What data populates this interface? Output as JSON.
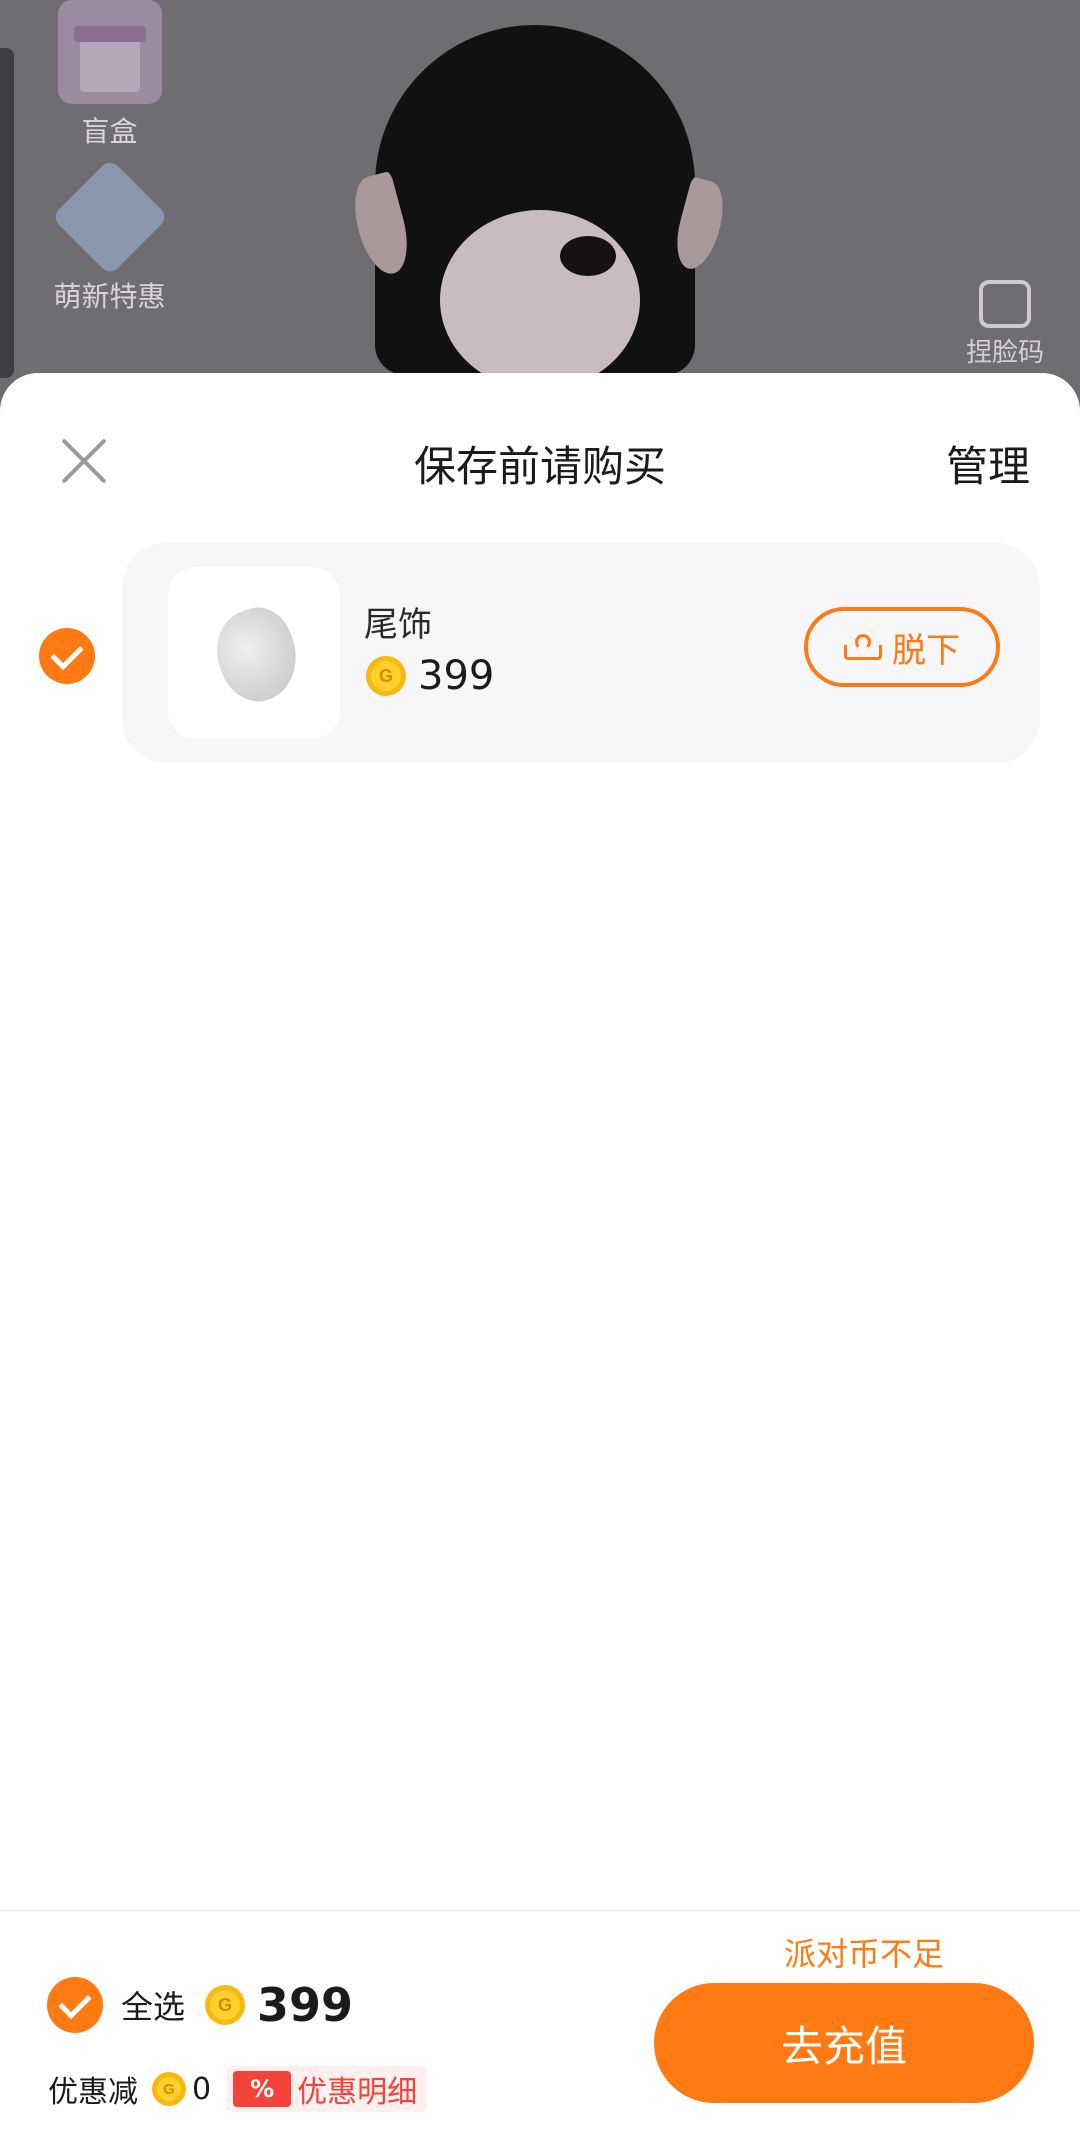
{
  "background": {
    "side_entries": [
      {
        "label": "盲盒",
        "icon": "gift-box-icon"
      },
      {
        "label": "萌新特惠",
        "icon": "promo-characters-icon"
      }
    ],
    "face_scan_label": "捏脸码"
  },
  "sheet": {
    "title": "保存前请购买",
    "manage_label": "管理",
    "items": [
      {
        "name": "尾饰",
        "price": "399",
        "selected": true,
        "action_label": "脱下",
        "thumbnail": "tail-accessory-icon"
      }
    ]
  },
  "footer": {
    "insufficient_text": "派对币不足",
    "select_all_label": "全选",
    "total": "399",
    "discount_label": "优惠减",
    "discount_value": "0",
    "percent_tag": "%",
    "detail_label": "优惠明细",
    "recharge_label": "去充值"
  },
  "colors": {
    "accent": "#ff7a13",
    "coin": "#f5b912",
    "discount_red": "#f2423a"
  }
}
